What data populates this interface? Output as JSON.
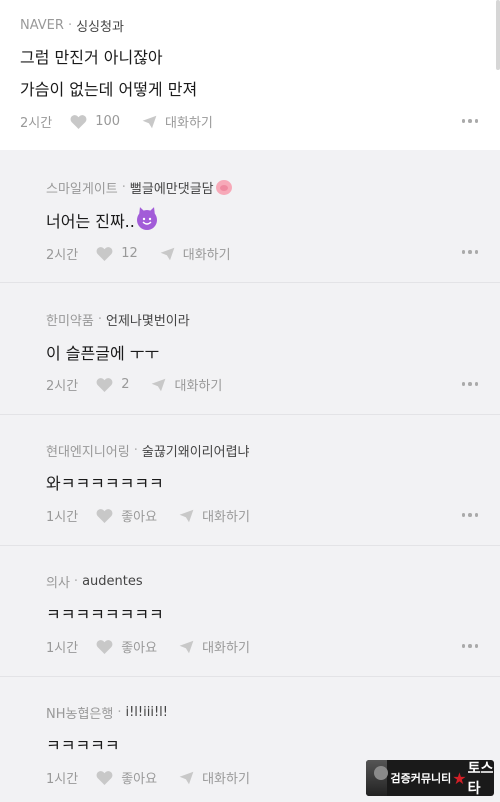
{
  "post": {
    "source": "NAVER",
    "nickname": "싱싱청과",
    "lines": [
      "그럼 만진거 아니잖아",
      "가슴이 없는데 어떻게 만져"
    ],
    "time": "2시간",
    "like_count": "100",
    "reply_label": "대화하기"
  },
  "replies": [
    {
      "org": "스마일게이트",
      "nickname": "뻘글에만댓글담",
      "text": "너어는 진짜..",
      "emoji": "smiling-devil",
      "time": "2시간",
      "like": "12",
      "reply_label": "대화하기"
    },
    {
      "org": "한미약품",
      "nickname": "언제나몇번이라",
      "text": "이 슬픈글에 ㅜㅜ",
      "time": "2시간",
      "like": "2",
      "reply_label": "대화하기"
    },
    {
      "org": "현대엔지니어링",
      "nickname": "술끊기왜이리어렵냐",
      "text": "와ㅋㅋㅋㅋㅋㅋㅋ",
      "time": "1시간",
      "like": "좋아요",
      "reply_label": "대화하기"
    },
    {
      "org": "의사",
      "nickname": "audentes",
      "text": "ㅋㅋㅋㅋㅋㅋㅋㅋ",
      "time": "1시간",
      "like": "좋아요",
      "reply_label": "대화하기"
    },
    {
      "org": "NH농협은행",
      "nickname": "i!l!iii!l!",
      "text": "ㅋㅋㅋㅋㅋ",
      "time": "1시간",
      "like": "좋아요",
      "reply_label": "대화하기"
    }
  ],
  "watermark": {
    "text": "검증커뮤니티",
    "brand": "토스타"
  },
  "colors": {
    "background": "#f2f2f4",
    "post_background": "#ffffff",
    "meta_text": "#999999",
    "body_text": "#1a1a1a"
  }
}
